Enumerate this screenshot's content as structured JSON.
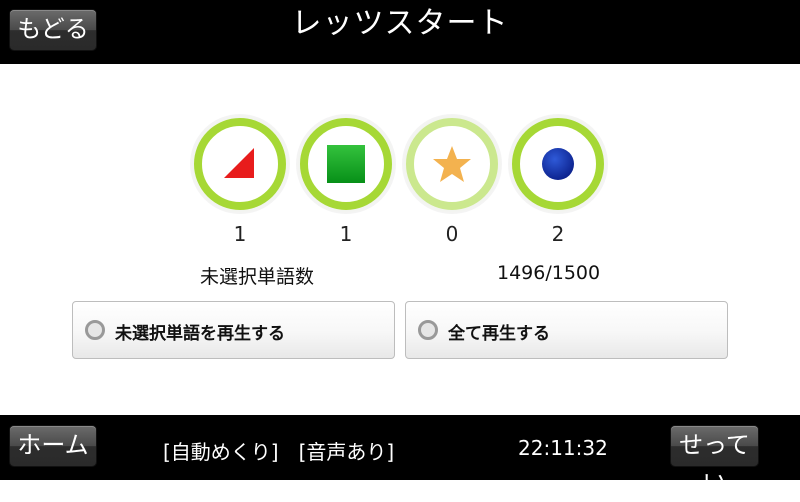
{
  "header": {
    "back_label": "もどる",
    "title": "レッツスタート"
  },
  "markers": [
    {
      "icon": "triangle-icon",
      "color": "#e81c1c",
      "count": "1"
    },
    {
      "icon": "square-icon",
      "color": "#0a9a1c",
      "count": "1"
    },
    {
      "icon": "star-icon",
      "color": "#f3b24f",
      "count": "0"
    },
    {
      "icon": "circle-icon",
      "color": "#1030a8",
      "count": "2"
    }
  ],
  "stats": {
    "unselected_label": "未選択単語数",
    "unselected_ratio": "1496/1500"
  },
  "actions": {
    "play_unselected": "未選択単語を再生する",
    "play_all": "全て再生する"
  },
  "footer": {
    "home_label": "ホーム",
    "mode_text": "[自動めくり]　[音声あり]",
    "clock": "22:11:32",
    "settings_label": "せってい"
  },
  "colors": {
    "ring": "#a6d835",
    "ring_dim": "#cbe88e",
    "bar": "#000000"
  }
}
